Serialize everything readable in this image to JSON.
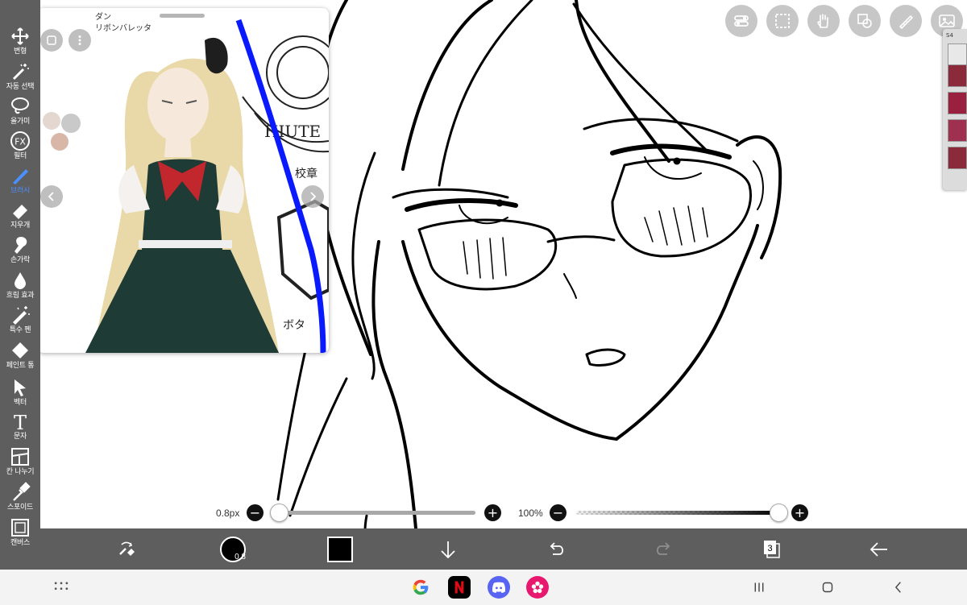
{
  "left_toolbar": {
    "tools": [
      {
        "label": "변형",
        "icon": "move-icon"
      },
      {
        "label": "자동 선택",
        "icon": "magic-wand-icon"
      },
      {
        "label": "올가미",
        "icon": "lasso-icon"
      },
      {
        "label": "필터",
        "icon": "fx-icon"
      },
      {
        "label": "브러시",
        "icon": "brush-icon",
        "active": true
      },
      {
        "label": "지우개",
        "icon": "eraser-icon"
      },
      {
        "label": "손가락",
        "icon": "smudge-icon"
      },
      {
        "label": "흐림 효과",
        "icon": "blur-drop-icon"
      },
      {
        "label": "특수 펜",
        "icon": "special-pen-icon"
      },
      {
        "label": "페인트 통",
        "icon": "paint-bucket-icon"
      },
      {
        "label": "벡터",
        "icon": "vector-cursor-icon"
      },
      {
        "label": "문자",
        "icon": "text-icon"
      },
      {
        "label": "칸 나누기",
        "icon": "frame-divider-icon"
      },
      {
        "label": "스포이드",
        "icon": "eyedropper-icon"
      },
      {
        "label": "캔버스",
        "icon": "canvas-icon"
      }
    ],
    "fx_text": "FX",
    "text_tool_glyph": "T"
  },
  "reference_window": {
    "note_line1": "ダン",
    "note_line2": "リボンバレッタ",
    "label_school": "校章",
    "label_button": "ボタ",
    "emblem_text": "HIUTE"
  },
  "slider_row": {
    "brush_size": "0.8px",
    "opacity": "100%",
    "size_value": 0.1,
    "opacity_value": 1.0
  },
  "bottom_toolbar": {
    "brush_size_badge": "0.8",
    "layer_count": "3",
    "primary_color": "#000000"
  },
  "layer_mini": {
    "header": "S4"
  },
  "colors": {
    "toolbar_bg": "#5e5e5e",
    "active_tool": "#4a90ff",
    "guide_line": "#0a1aff"
  }
}
